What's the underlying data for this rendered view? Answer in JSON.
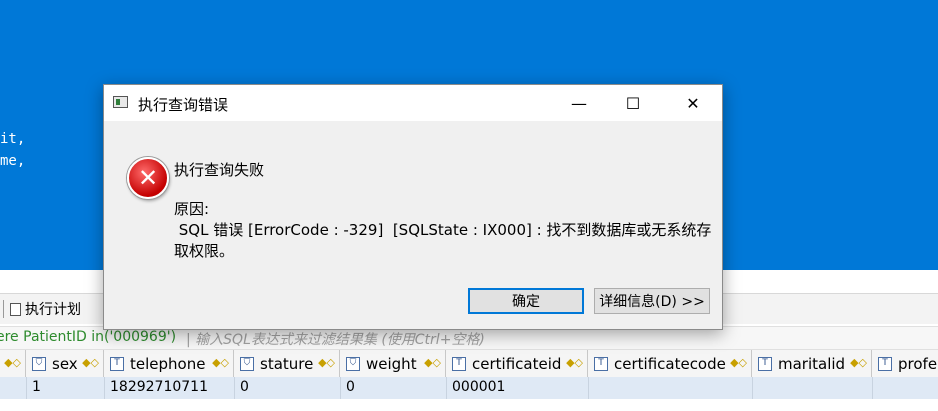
{
  "editor": {
    "code_lines": [
      "it,",
      "me,"
    ]
  },
  "toolbar": {
    "exec_plan_label": "执行计划"
  },
  "filter": {
    "expression": "ere PatientID in('000969')",
    "placeholder": "| 输入SQL表达式来过滤结果集 (使用Ctrl+空格)"
  },
  "grid": {
    "columns": [
      {
        "name": "sex",
        "icon": "⛉"
      },
      {
        "name": "telephone",
        "icon": "T"
      },
      {
        "name": "stature",
        "icon": "⛉"
      },
      {
        "name": "weight",
        "icon": "⛉"
      },
      {
        "name": "certificateid",
        "icon": "T"
      },
      {
        "name": "certificatecode",
        "icon": "T"
      },
      {
        "name": "maritalid",
        "icon": "T"
      },
      {
        "name": "profe",
        "icon": "T"
      }
    ],
    "rows": [
      [
        "1",
        "18292710711",
        "0",
        "0",
        "000001",
        "",
        "",
        ""
      ]
    ]
  },
  "dialog": {
    "title": "执行查询错误",
    "minimize": "—",
    "maximize": "☐",
    "close": "✕",
    "main_message": "执行查询失败",
    "reason_label": "原因:",
    "reason_line1": " SQL 错误 [ErrorCode : -329]  [SQLState : IX000] : 找不到数据库或无系统存",
    "reason_line2": "取权限。",
    "ok_label": "确定",
    "details_label": "详细信息(D) >>"
  },
  "colors": {
    "editor_bg": "#0078d7",
    "filter_text": "#2e8b2e",
    "selected_row": "#dfe9f5"
  }
}
